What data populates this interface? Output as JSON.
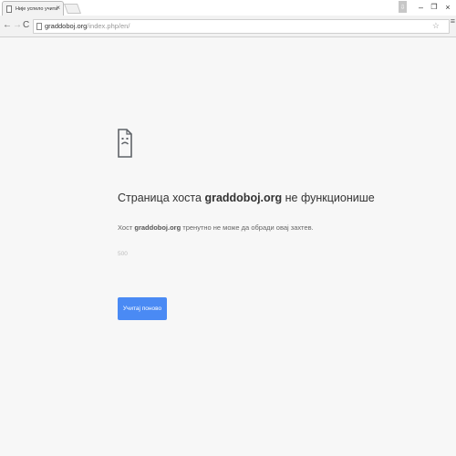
{
  "tab": {
    "title": "Није успело учитавање",
    "close_glyph": "×"
  },
  "window_controls": {
    "profile_glyph": "⇩",
    "minimize_glyph": "–",
    "restore_glyph": "❐",
    "close_glyph": "×"
  },
  "toolbar": {
    "back_glyph": "←",
    "forward_glyph": "→",
    "reload_glyph": "C",
    "url_host": "graddoboj.org",
    "url_path": "/index.php/en/",
    "star_glyph": "☆",
    "menu_glyph": "≡"
  },
  "error": {
    "heading_prefix": "Страница хоста ",
    "heading_host": "graddoboj.org",
    "heading_suffix": " не функционише",
    "desc_prefix": "Хост ",
    "desc_host": "graddoboj.org",
    "desc_suffix": " тренутно не може да обради овај захтев.",
    "code": "500",
    "reload_button": "Учитај поново"
  },
  "colors": {
    "accent": "#4a8af4",
    "background": "#f7f7f7"
  }
}
